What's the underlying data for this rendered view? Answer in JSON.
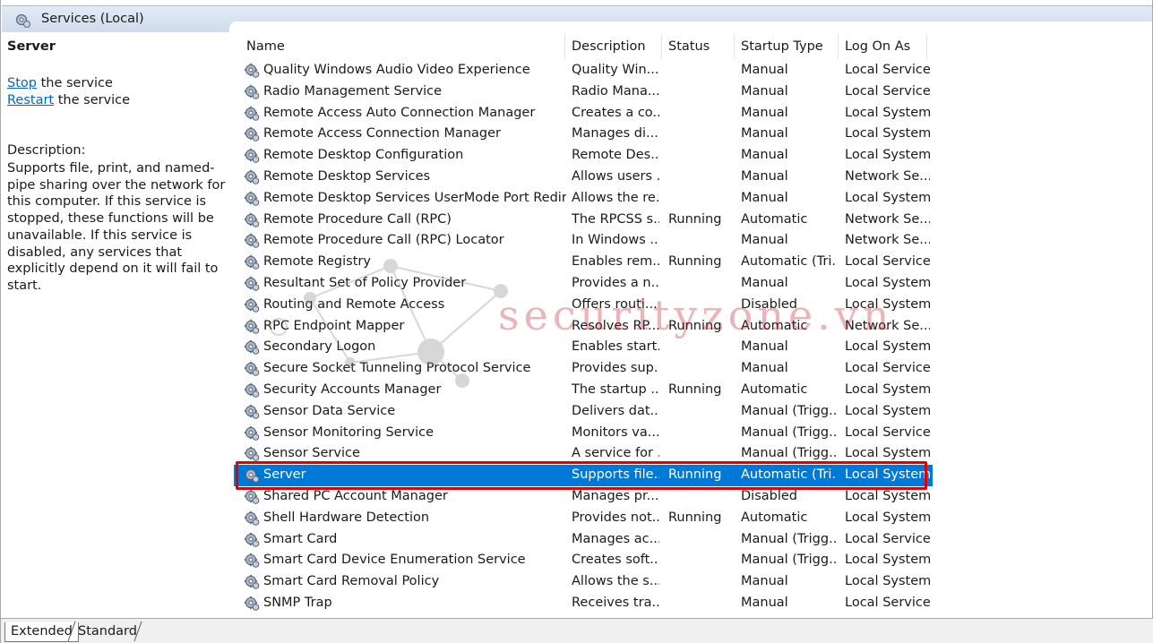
{
  "header": {
    "title": "Services (Local)",
    "icon": "services-gear-icon"
  },
  "left_panel": {
    "service_name": "Server",
    "stop_link": "Stop",
    "stop_suffix": " the service",
    "restart_link": "Restart",
    "restart_suffix": " the service",
    "description_label": "Description:",
    "description_text": "Supports file, print, and named-pipe sharing over the network for this computer. If this service is stopped, these functions will be unavailable. If this service is disabled, any services that explicitly depend on it will fail to start."
  },
  "columns": [
    "Name",
    "Description",
    "Status",
    "Startup Type",
    "Log On As"
  ],
  "rows": [
    {
      "name": "Quality Windows Audio Video Experience",
      "description": "Quality Win...",
      "status": "",
      "startup": "Manual",
      "logon": "Local Service"
    },
    {
      "name": "Radio Management Service",
      "description": "Radio Mana...",
      "status": "",
      "startup": "Manual",
      "logon": "Local Service"
    },
    {
      "name": "Remote Access Auto Connection Manager",
      "description": "Creates a co...",
      "status": "",
      "startup": "Manual",
      "logon": "Local System"
    },
    {
      "name": "Remote Access Connection Manager",
      "description": "Manages di...",
      "status": "",
      "startup": "Manual",
      "logon": "Local System"
    },
    {
      "name": "Remote Desktop Configuration",
      "description": "Remote Des...",
      "status": "",
      "startup": "Manual",
      "logon": "Local System"
    },
    {
      "name": "Remote Desktop Services",
      "description": "Allows users ...",
      "status": "",
      "startup": "Manual",
      "logon": "Network Se..."
    },
    {
      "name": "Remote Desktop Services UserMode Port Redirector",
      "description": "Allows the re...",
      "status": "",
      "startup": "Manual",
      "logon": "Local System"
    },
    {
      "name": "Remote Procedure Call (RPC)",
      "description": "The RPCSS s...",
      "status": "Running",
      "startup": "Automatic",
      "logon": "Network Se..."
    },
    {
      "name": "Remote Procedure Call (RPC) Locator",
      "description": "In Windows ...",
      "status": "",
      "startup": "Manual",
      "logon": "Network Se..."
    },
    {
      "name": "Remote Registry",
      "description": "Enables rem...",
      "status": "Running",
      "startup": "Automatic (Tri...",
      "logon": "Local Service"
    },
    {
      "name": "Resultant Set of Policy Provider",
      "description": "Provides a n...",
      "status": "",
      "startup": "Manual",
      "logon": "Local System"
    },
    {
      "name": "Routing and Remote Access",
      "description": "Offers routi...",
      "status": "",
      "startup": "Disabled",
      "logon": "Local System"
    },
    {
      "name": "RPC Endpoint Mapper",
      "description": "Resolves RP...",
      "status": "Running",
      "startup": "Automatic",
      "logon": "Network Se..."
    },
    {
      "name": "Secondary Logon",
      "description": "Enables start...",
      "status": "",
      "startup": "Manual",
      "logon": "Local System"
    },
    {
      "name": "Secure Socket Tunneling Protocol Service",
      "description": "Provides sup...",
      "status": "",
      "startup": "Manual",
      "logon": "Local Service"
    },
    {
      "name": "Security Accounts Manager",
      "description": "The startup ...",
      "status": "Running",
      "startup": "Automatic",
      "logon": "Local System"
    },
    {
      "name": "Sensor Data Service",
      "description": "Delivers dat...",
      "status": "",
      "startup": "Manual (Trigg...",
      "logon": "Local System"
    },
    {
      "name": "Sensor Monitoring Service",
      "description": "Monitors va...",
      "status": "",
      "startup": "Manual (Trigg...",
      "logon": "Local Service"
    },
    {
      "name": "Sensor Service",
      "description": "A service for ...",
      "status": "",
      "startup": "Manual (Trigg...",
      "logon": "Local System"
    },
    {
      "name": "Server",
      "description": "Supports file...",
      "status": "Running",
      "startup": "Automatic (Tri...",
      "logon": "Local System",
      "selected": true
    },
    {
      "name": "Shared PC Account Manager",
      "description": "Manages pr...",
      "status": "",
      "startup": "Disabled",
      "logon": "Local System"
    },
    {
      "name": "Shell Hardware Detection",
      "description": "Provides not...",
      "status": "Running",
      "startup": "Automatic",
      "logon": "Local System"
    },
    {
      "name": "Smart Card",
      "description": "Manages ac...",
      "status": "",
      "startup": "Manual (Trigg...",
      "logon": "Local Service"
    },
    {
      "name": "Smart Card Device Enumeration Service",
      "description": "Creates soft...",
      "status": "",
      "startup": "Manual (Trigg...",
      "logon": "Local System"
    },
    {
      "name": "Smart Card Removal Policy",
      "description": "Allows the s...",
      "status": "",
      "startup": "Manual",
      "logon": "Local System"
    },
    {
      "name": "SNMP Trap",
      "description": "Receives tra...",
      "status": "",
      "startup": "Manual",
      "logon": "Local Service"
    }
  ],
  "watermark": {
    "text": "securityzone.vn"
  },
  "tabs": [
    "Extended",
    "Standard"
  ],
  "colors": {
    "selection": "#0078d7",
    "link": "#0066cc",
    "highlight_border": "#e00000",
    "watermark": "#c21f2a"
  }
}
